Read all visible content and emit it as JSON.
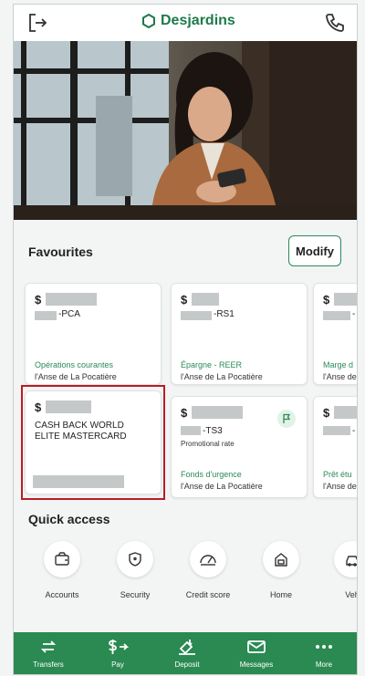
{
  "header": {
    "brand": "Desjardins",
    "logout_icon": "logout-icon",
    "phone_icon": "phone-icon",
    "brand_color": "#1d7a4a"
  },
  "favourites": {
    "title": "Favourites",
    "modify_label": "Modify",
    "cards": [
      {
        "currency": "$",
        "account_suffix": "-PCA",
        "type": "Opérations courantes",
        "branch": "l'Anse de La Pocatière"
      },
      {
        "currency": "$",
        "account_suffix": "-RS1",
        "type": "Épargne - REER",
        "branch": "l'Anse de La Pocatière"
      },
      {
        "currency": "$",
        "account_suffix": "-",
        "type": "Marge d",
        "branch": "l'Anse de"
      },
      {
        "currency": "$",
        "name": "CASH BACK WORLD ELITE MASTERCARD"
      },
      {
        "currency": "$",
        "account_suffix": "-TS3",
        "promo": "Promotional rate",
        "type": "Fonds d'urgence",
        "branch": "l'Anse de La Pocatière"
      },
      {
        "currency": "$",
        "account_suffix": "-",
        "type": "Prêt étu",
        "branch": "l'Anse de"
      }
    ]
  },
  "quick_access": {
    "title": "Quick access",
    "items": [
      {
        "label": "Accounts",
        "icon": "wallet-icon"
      },
      {
        "label": "Security",
        "icon": "shield-icon"
      },
      {
        "label": "Credit score",
        "icon": "gauge-icon"
      },
      {
        "label": "Home",
        "icon": "home-icon"
      },
      {
        "label": "Veh",
        "icon": "vehicle-icon"
      }
    ]
  },
  "bottom_nav": {
    "items": [
      {
        "label": "Transfers",
        "icon": "transfer-icon"
      },
      {
        "label": "Pay",
        "icon": "pay-icon"
      },
      {
        "label": "Deposit",
        "icon": "deposit-icon"
      },
      {
        "label": "Messages",
        "icon": "envelope-icon"
      },
      {
        "label": "More",
        "icon": "more-icon"
      }
    ],
    "color": "#2a8a52"
  }
}
